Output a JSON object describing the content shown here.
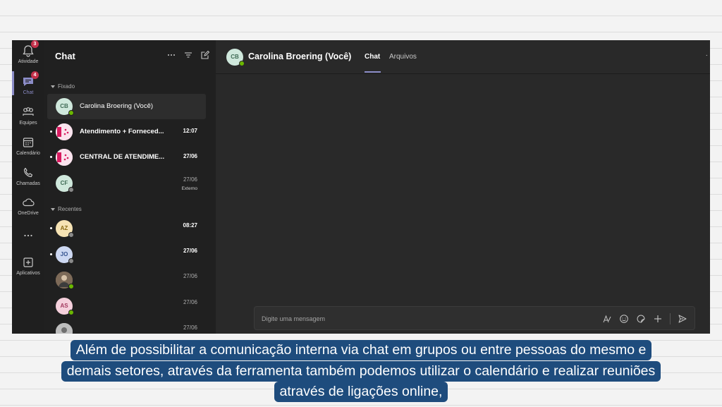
{
  "app_bar": {
    "items": [
      {
        "label": "Atividade",
        "icon": "bell-icon",
        "badge": "3"
      },
      {
        "label": "Chat",
        "icon": "chat-icon",
        "badge": "4"
      },
      {
        "label": "Equipes",
        "icon": "teams-icon"
      },
      {
        "label": "Calendário",
        "icon": "calendar-icon"
      },
      {
        "label": "Chamadas",
        "icon": "phone-icon"
      },
      {
        "label": "OneDrive",
        "icon": "cloud-icon"
      },
      {
        "label": "...",
        "icon": "more-icon"
      },
      {
        "label": "Aplicativos",
        "icon": "add-app-icon"
      }
    ]
  },
  "chat_list": {
    "title": "Chat",
    "more_label": "···",
    "sections": {
      "pinned": "Fixado",
      "recent": "Recentes"
    },
    "pinned": [
      {
        "initials": "CB",
        "name": "Carolina Broering (Você)",
        "time": "",
        "status": "online",
        "avatar_bg": "#cfe8dc",
        "avatar_fg": "#3f6b55"
      },
      {
        "initials": "",
        "name": "Atendimento + Forneced...",
        "time": "12:07",
        "status": "",
        "avatar_bg": "#f4d3e1",
        "avatar_fg": "#c2185b"
      },
      {
        "initials": "",
        "name": "CENTRAL DE ATENDIME...",
        "time": "27/06",
        "status": "",
        "avatar_bg": "#f4d3e1",
        "avatar_fg": "#c2185b"
      },
      {
        "initials": "CF",
        "name": "",
        "time": "27/06",
        "sub": "Externo",
        "status": "offline",
        "avatar_bg": "#cfe8dc",
        "avatar_fg": "#3f6b55"
      }
    ],
    "recent": [
      {
        "initials": "AZ",
        "name": "",
        "time": "08:27",
        "status": "offline",
        "avatar_bg": "#f6e3b4",
        "avatar_fg": "#8a6a13"
      },
      {
        "initials": "JO",
        "name": "",
        "time": "27/06",
        "status": "offline",
        "avatar_bg": "#cdd8f2",
        "avatar_fg": "#34528f"
      },
      {
        "initials": "",
        "name": "",
        "time": "27/06",
        "status": "online",
        "avatar_bg": "#9c7a5b",
        "avatar_fg": "#fff"
      },
      {
        "initials": "AS",
        "name": "",
        "time": "27/06",
        "status": "online",
        "avatar_bg": "#f5d0dc",
        "avatar_fg": "#a33a5f"
      },
      {
        "initials": "",
        "name": "",
        "time": "27/06",
        "status": "",
        "avatar_bg": "#cfcfcf",
        "avatar_fg": "#333"
      }
    ]
  },
  "conversation": {
    "initials": "CB",
    "name": "Carolina Broering (Você)",
    "tabs": [
      "Chat",
      "Arquivos"
    ],
    "composer_placeholder": "Digite uma mensagem"
  },
  "caption": {
    "lines": [
      "Além de possibilitar a comunicação interna via chat em grupos ou entre pessoas do mesmo e",
      "demais setores, através da ferramenta também podemos utilizar o calendário e realizar reuniões",
      "através de ligações online,"
    ]
  },
  "colors": {
    "accent": "#8b8cc7",
    "badge": "#c4314b",
    "online": "#6bb700",
    "caption_bg": "#1e4c7d"
  }
}
